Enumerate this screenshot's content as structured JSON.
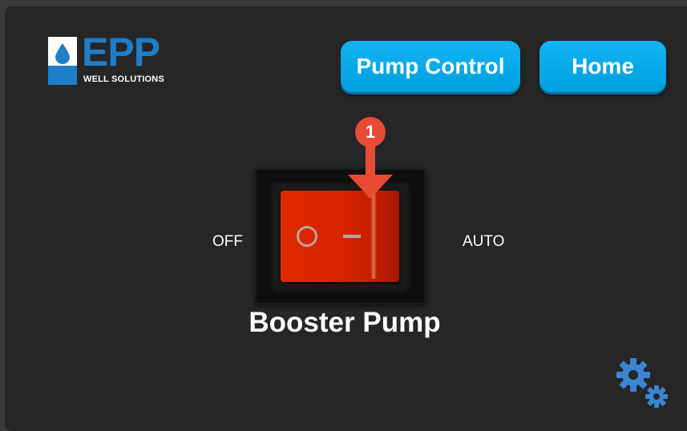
{
  "logo": {
    "brand": "EPP",
    "tagline": "WELL SOLUTIONS"
  },
  "nav": {
    "pump_control_label": "Pump Control",
    "home_label": "Home"
  },
  "switch": {
    "off_label": "OFF",
    "auto_label": "AUTO",
    "title": "Booster Pump",
    "state": "OFF"
  },
  "annotation": {
    "step_number": "1"
  },
  "colors": {
    "accent_button": "#00A3E0",
    "rocker_red": "#D52300",
    "callout_red": "#E94B35",
    "brand_blue": "#1E7EC8",
    "gear_blue": "#3A86D4"
  },
  "icons": {
    "settings": "gears-icon",
    "water_drop": "water-drop-icon"
  }
}
